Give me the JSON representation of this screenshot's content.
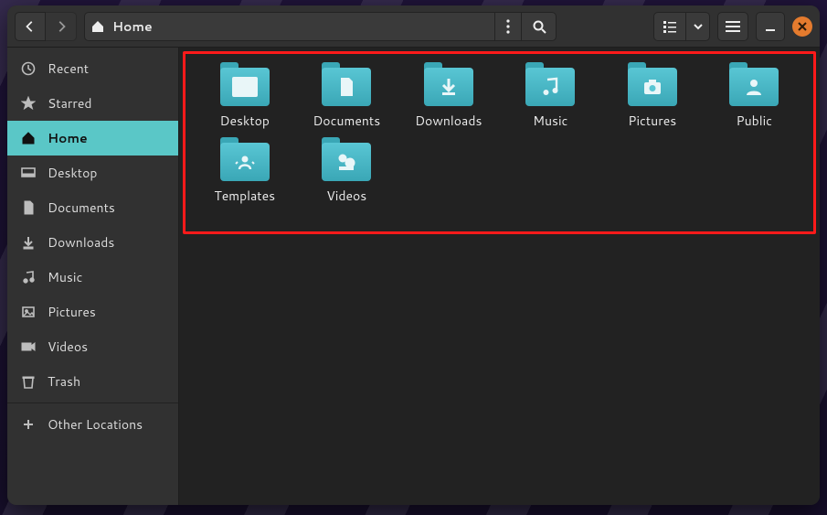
{
  "path": {
    "label": "Home"
  },
  "sidebar": {
    "items": [
      {
        "label": "Recent"
      },
      {
        "label": "Starred"
      },
      {
        "label": "Home"
      },
      {
        "label": "Desktop"
      },
      {
        "label": "Documents"
      },
      {
        "label": "Downloads"
      },
      {
        "label": "Music"
      },
      {
        "label": "Pictures"
      },
      {
        "label": "Videos"
      },
      {
        "label": "Trash"
      }
    ],
    "other": "Other Locations"
  },
  "folders": [
    {
      "label": "Desktop"
    },
    {
      "label": "Documents"
    },
    {
      "label": "Downloads"
    },
    {
      "label": "Music"
    },
    {
      "label": "Pictures"
    },
    {
      "label": "Public"
    },
    {
      "label": "Templates"
    },
    {
      "label": "Videos"
    }
  ]
}
